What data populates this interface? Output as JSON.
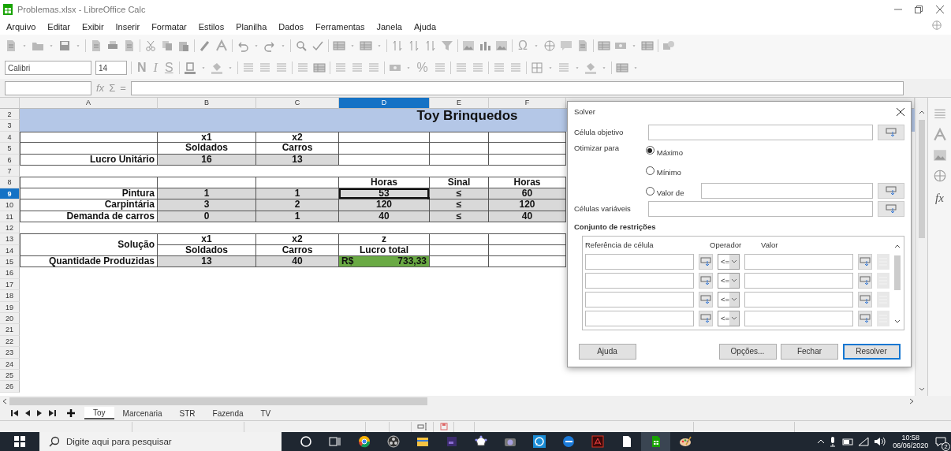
{
  "window": {
    "title": "Problemas.xlsx - LibreOffice Calc"
  },
  "menu": [
    "Arquivo",
    "Editar",
    "Exibir",
    "Inserir",
    "Formatar",
    "Estilos",
    "Planilha",
    "Dados",
    "Ferramentas",
    "Janela",
    "Ajuda"
  ],
  "standard_toolbar": {
    "special_character": "Ω"
  },
  "format_toolbar": {
    "font_name": "Calibri",
    "font_size": "14",
    "bold": "N",
    "italic": "I",
    "underline": "S",
    "percent": "%"
  },
  "formula_bar": {
    "function_wizard": "fx",
    "sum": "Σ",
    "equals": "="
  },
  "sheet": {
    "columns": [
      {
        "label": "A",
        "selected": false
      },
      {
        "label": "B",
        "selected": false
      },
      {
        "label": "C",
        "selected": false
      },
      {
        "label": "D",
        "selected": true
      },
      {
        "label": "E",
        "selected": false
      },
      {
        "label": "F",
        "selected": false
      }
    ],
    "rows": [
      {
        "number": "2",
        "selected": false,
        "cells": [
          {
            "kind": "title",
            "text": "Toy Brinquedos"
          }
        ]
      },
      {
        "number": "3",
        "selected": false
      },
      {
        "number": "4",
        "selected": false,
        "cells": [
          {
            "kind": "blank",
            "selected": false
          },
          {
            "kind": "header",
            "text": "x1",
            "selected": false
          },
          {
            "kind": "header",
            "text": "x2",
            "selected": false
          },
          {
            "kind": "blank",
            "selected": false
          },
          {
            "kind": "blank",
            "selected": false
          },
          {
            "kind": "blank",
            "selected": false
          }
        ]
      },
      {
        "number": "5",
        "selected": false,
        "cells": [
          {
            "kind": "blank",
            "selected": false
          },
          {
            "kind": "header",
            "text": "Soldados",
            "selected": false
          },
          {
            "kind": "header",
            "text": "Carros",
            "selected": false
          },
          {
            "kind": "blank",
            "selected": false
          },
          {
            "kind": "blank",
            "selected": false
          },
          {
            "kind": "blank",
            "selected": false
          }
        ]
      },
      {
        "number": "6",
        "selected": false,
        "cells": [
          {
            "kind": "label",
            "text": "Lucro Unitário",
            "selected": false
          },
          {
            "kind": "value",
            "text": "16",
            "selected": false
          },
          {
            "kind": "value",
            "text": "13",
            "selected": false
          },
          {
            "kind": "blank",
            "selected": false
          },
          {
            "kind": "blank",
            "selected": false
          },
          {
            "kind": "blank",
            "selected": false
          }
        ]
      },
      {
        "number": "7",
        "selected": false
      },
      {
        "number": "8",
        "selected": false,
        "cells": [
          {
            "kind": "blank",
            "selected": false
          },
          {
            "kind": "blank",
            "selected": false
          },
          {
            "kind": "blank",
            "selected": false
          },
          {
            "kind": "header",
            "text": "Horas",
            "selected": false
          },
          {
            "kind": "header",
            "text": "Sinal",
            "selected": false
          },
          {
            "kind": "header",
            "text": "Horas",
            "selected": false
          }
        ]
      },
      {
        "number": "9",
        "selected": true,
        "cells": [
          {
            "kind": "label",
            "text": "Pintura",
            "selected": false
          },
          {
            "kind": "value",
            "text": "1",
            "selected": false
          },
          {
            "kind": "value",
            "text": "1",
            "selected": false
          },
          {
            "kind": "value",
            "text": "53",
            "selected": true
          },
          {
            "kind": "value",
            "text": "≤",
            "selected": false
          },
          {
            "kind": "value",
            "text": "60",
            "selected": false
          }
        ]
      },
      {
        "number": "10",
        "selected": false,
        "cells": [
          {
            "kind": "label",
            "text": "Carpintária",
            "selected": false
          },
          {
            "kind": "value",
            "text": "3",
            "selected": false
          },
          {
            "kind": "value",
            "text": "2",
            "selected": false
          },
          {
            "kind": "value",
            "text": "120",
            "selected": false
          },
          {
            "kind": "value",
            "text": "≤",
            "selected": false
          },
          {
            "kind": "value",
            "text": "120",
            "selected": false
          }
        ]
      },
      {
        "number": "11",
        "selected": false,
        "cells": [
          {
            "kind": "label",
            "text": "Demanda de carros",
            "selected": false
          },
          {
            "kind": "value",
            "text": "0",
            "selected": false
          },
          {
            "kind": "value",
            "text": "1",
            "selected": false
          },
          {
            "kind": "value",
            "text": "40",
            "selected": false
          },
          {
            "kind": "value",
            "text": "≤",
            "selected": false
          },
          {
            "kind": "value",
            "text": "40",
            "selected": false
          }
        ]
      },
      {
        "number": "12",
        "selected": false
      },
      {
        "number": "13",
        "selected": false,
        "cells": [
          {
            "kind": "tall-label",
            "text": "Solução",
            "selected": false
          },
          {
            "kind": "header",
            "text": "x1",
            "selected": false
          },
          {
            "kind": "header",
            "text": "x2",
            "selected": false
          },
          {
            "kind": "header",
            "text": "z",
            "selected": false
          },
          {
            "kind": "blank",
            "selected": false
          },
          {
            "kind": "blank",
            "selected": false
          }
        ]
      },
      {
        "number": "14",
        "selected": false,
        "cells": [
          {
            "kind": "merged"
          },
          {
            "kind": "header",
            "text": "Soldados",
            "selected": false
          },
          {
            "kind": "header",
            "text": "Carros",
            "selected": false
          },
          {
            "kind": "header",
            "text": "Lucro total",
            "selected": false
          },
          {
            "kind": "blank",
            "selected": false
          },
          {
            "kind": "blank",
            "selected": false
          }
        ]
      },
      {
        "number": "15",
        "selected": false,
        "cells": [
          {
            "kind": "label",
            "text": "Quantidade Produzidas",
            "selected": false
          },
          {
            "kind": "value",
            "text": "13",
            "selected": false
          },
          {
            "kind": "value",
            "text": "40",
            "selected": false
          },
          {
            "kind": "currency",
            "text": "R$",
            "amount": "733,33",
            "selected": false
          },
          {
            "kind": "blank",
            "selected": false
          },
          {
            "kind": "blank",
            "selected": false
          }
        ]
      },
      {
        "number": "16",
        "selected": false
      },
      {
        "number": "17",
        "selected": false
      },
      {
        "number": "18",
        "selected": false
      },
      {
        "number": "19",
        "selected": false
      },
      {
        "number": "20",
        "selected": false
      },
      {
        "number": "21",
        "selected": false
      },
      {
        "number": "22",
        "selected": false
      },
      {
        "number": "23",
        "selected": false
      },
      {
        "number": "24",
        "selected": false
      },
      {
        "number": "25",
        "selected": false
      },
      {
        "number": "26",
        "selected": false
      }
    ]
  },
  "dialog": {
    "title": "Solver",
    "target_label": "Célula objetivo",
    "optimize_label": "Otimizar para",
    "options": [
      {
        "label": "Máximo",
        "selected": true
      },
      {
        "label": "Mínimo",
        "selected": false
      },
      {
        "label": "Valor de",
        "selected": false
      }
    ],
    "variable_label": "Células variáveis",
    "constraints_title": "Conjunto de restrições",
    "constraint_headers": [
      "Referência de célula",
      "Operador",
      "Valor"
    ],
    "constraints": [
      {
        "operator": "<="
      },
      {
        "operator": "<="
      },
      {
        "operator": "<="
      },
      {
        "operator": "<="
      }
    ],
    "buttons": [
      {
        "label": "Ajuda",
        "default": false
      },
      {
        "label": "Opções...",
        "default": false
      },
      {
        "label": "Fechar",
        "default": false
      },
      {
        "label": "Resolver",
        "default": true
      }
    ]
  },
  "sheet_tabs": [
    {
      "label": "Toy",
      "selected": true
    },
    {
      "label": "Marcenaria",
      "selected": false
    },
    {
      "label": "STR",
      "selected": false
    },
    {
      "label": "Fazenda",
      "selected": false
    },
    {
      "label": "TV",
      "selected": false
    }
  ],
  "sidebar": {
    "function_label": "fx"
  },
  "taskbar": {
    "search_placeholder": "Digite aqui para pesquisar",
    "time": "10:58",
    "date": "06/06/2020",
    "notifications": "2"
  }
}
